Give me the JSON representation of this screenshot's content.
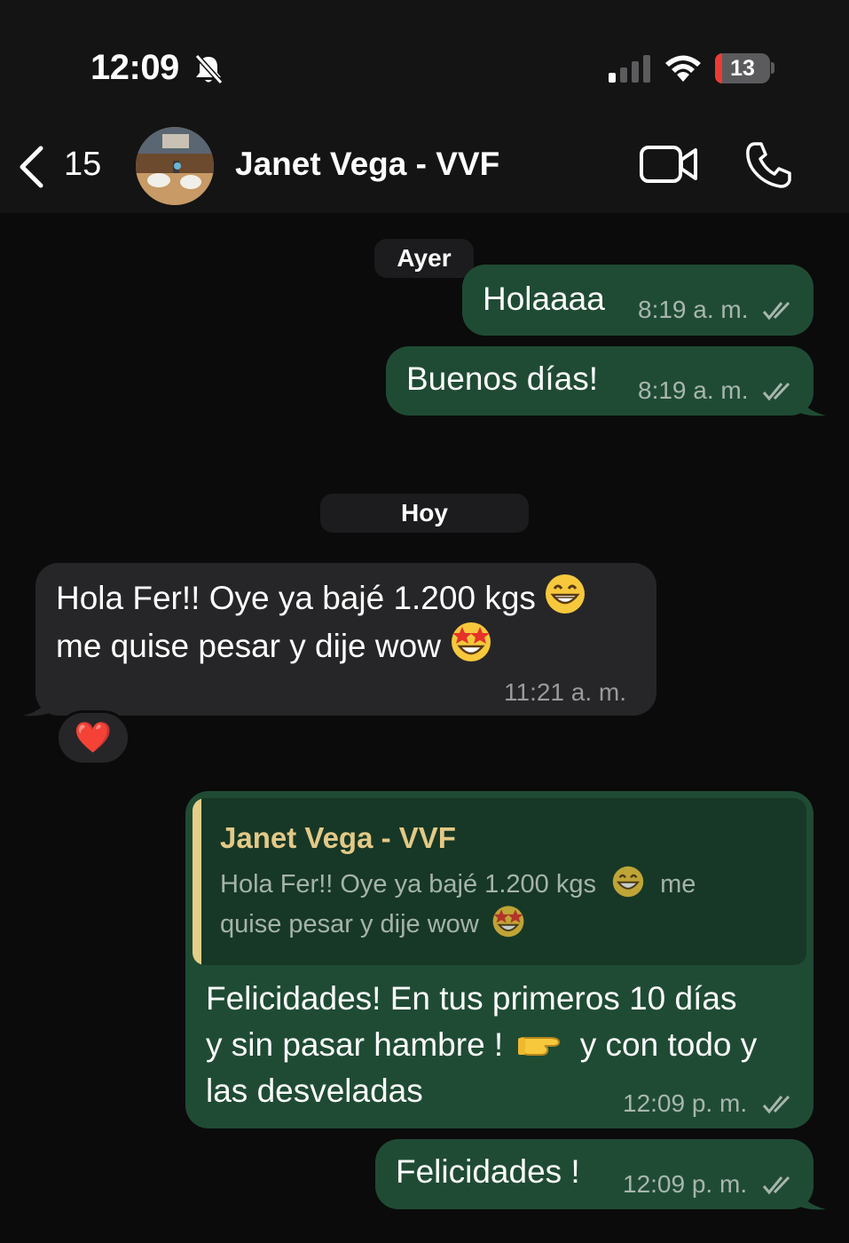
{
  "status_bar": {
    "time": "12:09",
    "battery_percent": "13",
    "battery_level": 0.13,
    "icons": [
      "bell-slash-icon",
      "cellular-signal-icon",
      "wifi-icon",
      "battery-icon"
    ]
  },
  "header": {
    "back_count": "15",
    "contact_name": "Janet Vega - VVF",
    "icons": [
      "back-chevron-icon",
      "video-camera-icon",
      "phone-icon"
    ]
  },
  "chat": {
    "day_yesterday": "Ayer",
    "day_today": "Hoy",
    "messages": [
      {
        "direction": "outgoing",
        "text": "Holaaaa",
        "time": "8:19",
        "period": "a. m.",
        "status": "read"
      },
      {
        "direction": "outgoing",
        "text": "Buenos días!",
        "time": "8:19",
        "period": "a. m.",
        "status": "read"
      },
      {
        "direction": "incoming",
        "line1": "Hola Fer!! Oye ya bajé 1.200 kgs",
        "line2": "me quise pesar y dije wow",
        "time": "11:21",
        "period": "a. m.",
        "reaction": "❤️"
      },
      {
        "direction": "outgoing",
        "reply_author": "Janet Vega - VVF",
        "reply_line1a": "Hola Fer!! Oye ya bajé 1.200 kgs",
        "reply_line1b": "me",
        "reply_line2": "quise pesar y dije wow",
        "line1": "Felicidades! En tus primeros 10 días",
        "line2a": "y sin pasar hambre !",
        "line2b": "y con todo y",
        "line3": "las desveladas",
        "time": "12:09",
        "period": "p. m.",
        "status": "read"
      },
      {
        "direction": "outgoing",
        "text": "Felicidades !",
        "time": "12:09",
        "period": "p. m.",
        "status": "read"
      }
    ]
  },
  "colors": {
    "outgoing_bubble": "#1f4b34",
    "incoming_bubble": "#262628",
    "reply_accent": "#e3cf88",
    "background": "#0b0b0b"
  }
}
